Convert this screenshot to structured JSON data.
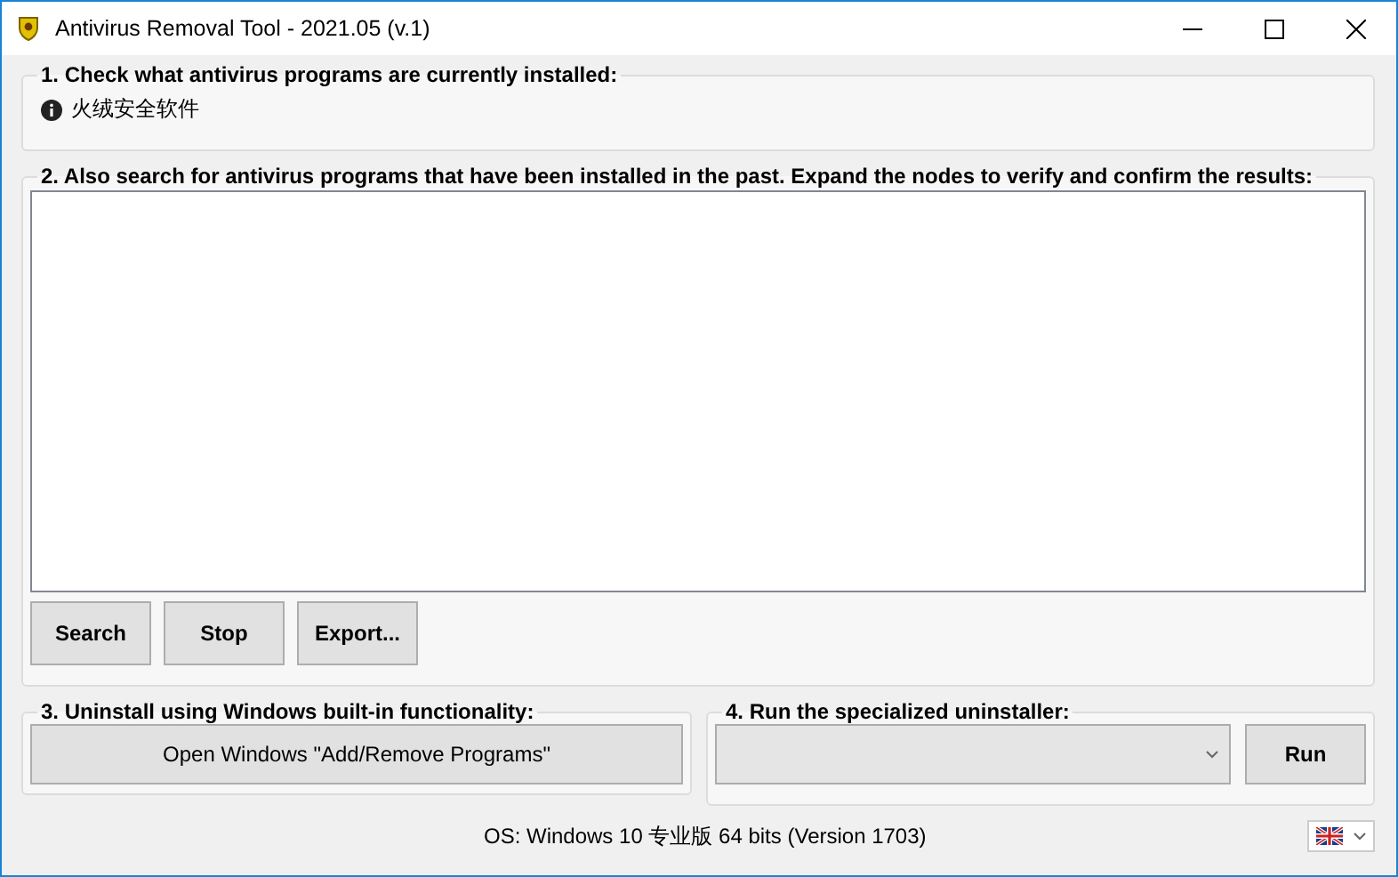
{
  "window": {
    "title": "Antivirus Removal Tool - 2021.05 (v.1)"
  },
  "installed": {
    "title": "1. Check what antivirus programs are currently installed:",
    "items": [
      {
        "text": "火绒安全软件"
      }
    ]
  },
  "history": {
    "title": "2. Also search for antivirus programs that have been installed in the past. Expand the nodes to verify and confirm the results:",
    "buttons": [
      "Search",
      "Stop",
      "Export..."
    ]
  },
  "windows_uninstall": {
    "title": "3. Uninstall using Windows built-in functionality:",
    "button": "Open Windows \"Add/Remove Programs\""
  },
  "specialized": {
    "title": "4. Run the specialized uninstaller:",
    "button": "Run"
  },
  "status_bar": {
    "text": "OS: Windows 10 专业版 64 bits (Version 1703)"
  }
}
